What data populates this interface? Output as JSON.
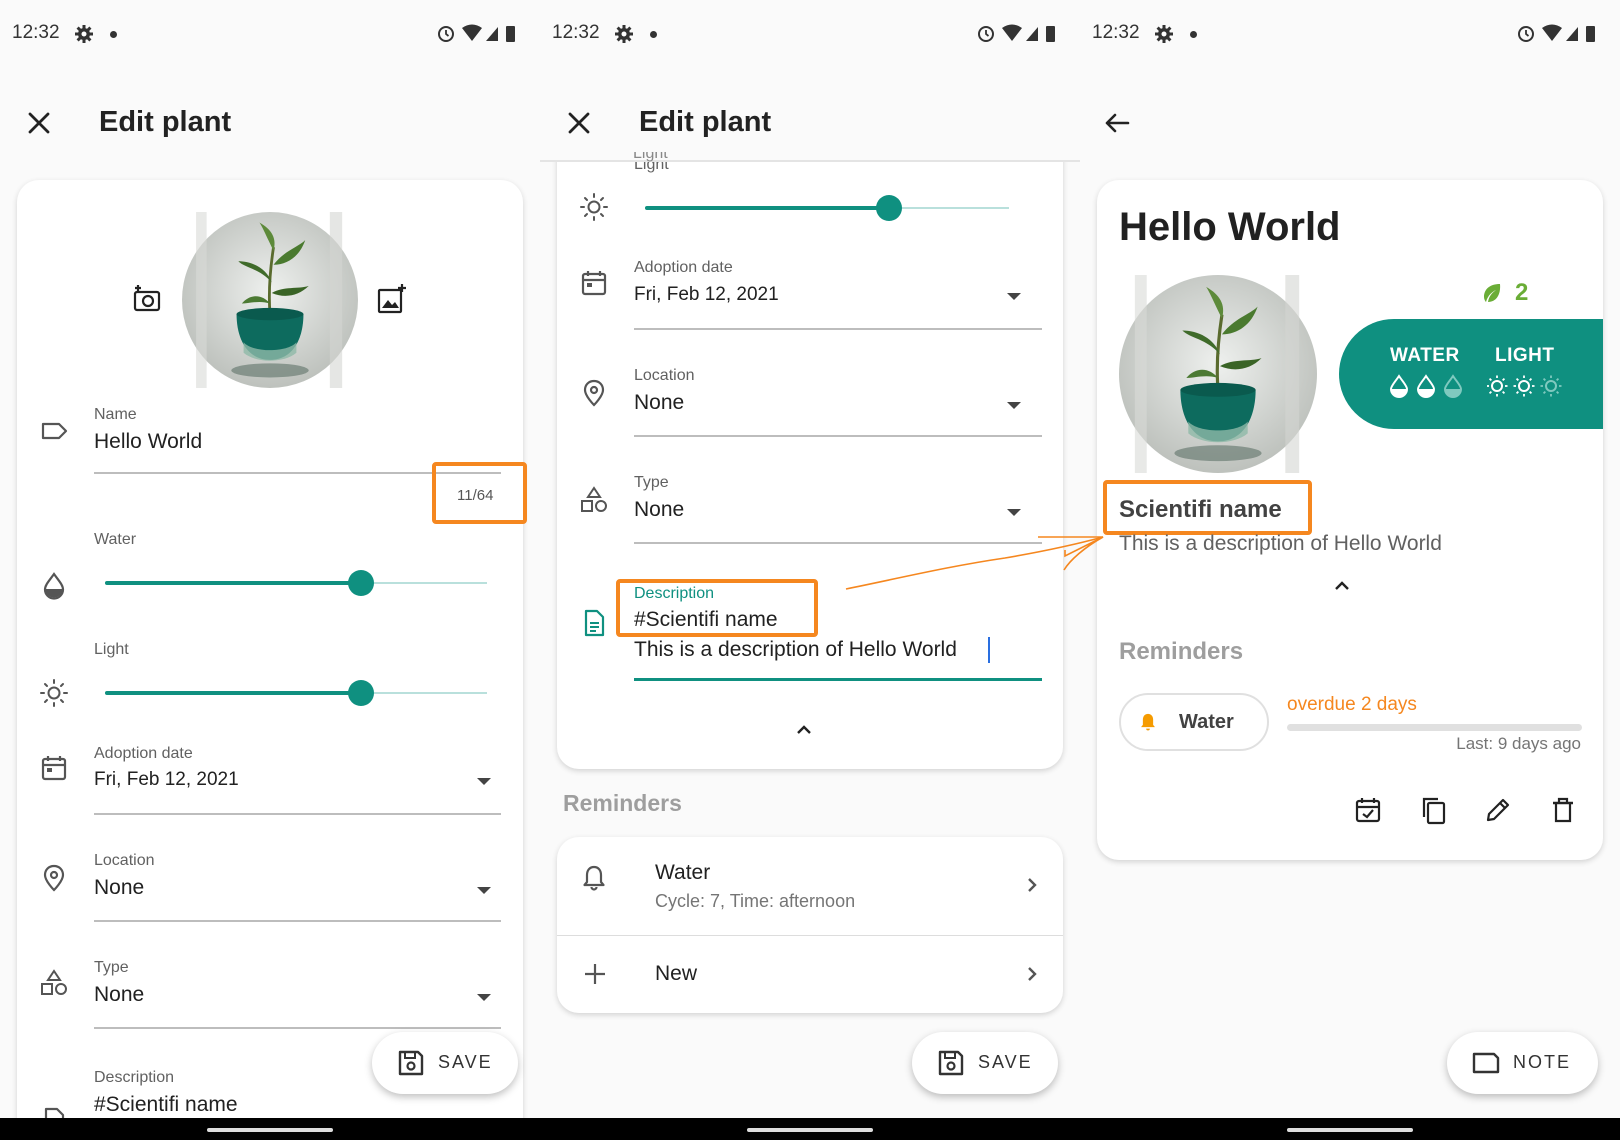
{
  "status": {
    "time": "12:32"
  },
  "edit1": {
    "title": "Edit plant",
    "name_label": "Name",
    "name_value": "Hello World",
    "char_counter": "11/64",
    "water_label": "Water",
    "water_level": 0.67,
    "light_label": "Light",
    "light_level": 0.67,
    "adoption_label": "Adoption date",
    "adoption_value": "Fri, Feb 12, 2021",
    "location_label": "Location",
    "location_value": "None",
    "type_label": "Type",
    "type_value": "None",
    "description_label": "Description",
    "description_value": "#Scientifi name",
    "save_label": "SAVE"
  },
  "edit2": {
    "title": "Edit plant",
    "light_label": "Light",
    "light_level": 0.67,
    "adoption_label": "Adoption date",
    "adoption_value": "Fri, Feb 12, 2021",
    "location_label": "Location",
    "location_value": "None",
    "type_label": "Type",
    "type_value": "None",
    "description_label": "Description",
    "description_line1": "#Scientifi name",
    "description_line2": "This is a description of Hello World",
    "reminders_heading": "Reminders",
    "reminder_name": "Water",
    "reminder_detail": "Cycle: 7, Time: afternoon",
    "new_label": "New",
    "save_label": "SAVE"
  },
  "detail": {
    "plant_name": "Hello World",
    "leaf_count": "2",
    "water_label": "WATER",
    "water_level": 2,
    "light_label": "LIGHT",
    "light_level": 2,
    "scale_max": 3,
    "scientific_name": "Scientifi name",
    "description": "This is a description of Hello World",
    "reminders_heading": "Reminders",
    "reminder_chip": "Water",
    "overdue_text": "overdue 2 days",
    "last_text": "Last: 9 days ago",
    "note_label": "NOTE"
  },
  "colors": {
    "accent": "#0f9080",
    "highlight": "#f5871f",
    "bell": "#f59b00"
  }
}
